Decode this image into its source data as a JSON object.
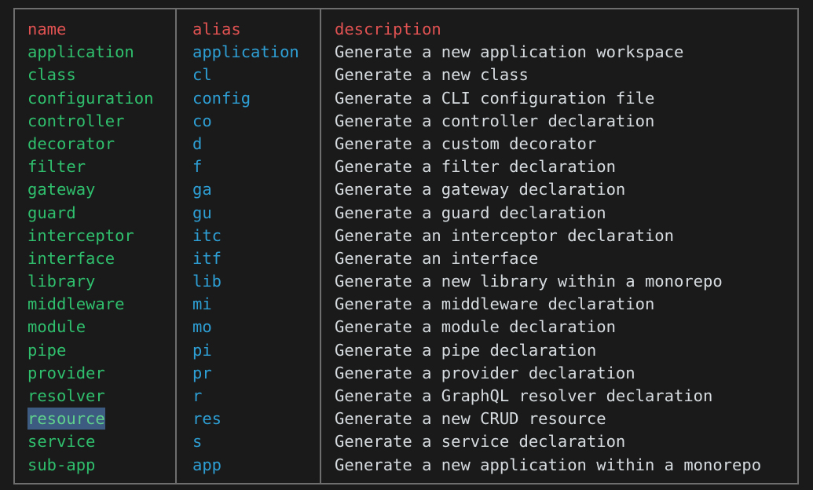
{
  "terminal": {
    "background_color": "#1a1a1a",
    "border_color": "#6e6e6e",
    "header_color": "#e05252",
    "name_color": "#2fbf6d",
    "alias_color": "#2e9fd4",
    "description_color": "#d7dce0",
    "selection_background": "#3d5a80"
  },
  "table": {
    "headers": {
      "name": "name",
      "alias": "alias",
      "description": "description"
    },
    "selected_row": "resource",
    "rows": [
      {
        "name": "application",
        "alias": "application",
        "description": "Generate a new application workspace"
      },
      {
        "name": "class",
        "alias": "cl",
        "description": "Generate a new class"
      },
      {
        "name": "configuration",
        "alias": "config",
        "description": "Generate a CLI configuration file"
      },
      {
        "name": "controller",
        "alias": "co",
        "description": "Generate a controller declaration"
      },
      {
        "name": "decorator",
        "alias": "d",
        "description": "Generate a custom decorator"
      },
      {
        "name": "filter",
        "alias": "f",
        "description": "Generate a filter declaration"
      },
      {
        "name": "gateway",
        "alias": "ga",
        "description": "Generate a gateway declaration"
      },
      {
        "name": "guard",
        "alias": "gu",
        "description": "Generate a guard declaration"
      },
      {
        "name": "interceptor",
        "alias": "itc",
        "description": "Generate an interceptor declaration"
      },
      {
        "name": "interface",
        "alias": "itf",
        "description": "Generate an interface"
      },
      {
        "name": "library",
        "alias": "lib",
        "description": "Generate a new library within a monorepo"
      },
      {
        "name": "middleware",
        "alias": "mi",
        "description": "Generate a middleware declaration"
      },
      {
        "name": "module",
        "alias": "mo",
        "description": "Generate a module declaration"
      },
      {
        "name": "pipe",
        "alias": "pi",
        "description": "Generate a pipe declaration"
      },
      {
        "name": "provider",
        "alias": "pr",
        "description": "Generate a provider declaration"
      },
      {
        "name": "resolver",
        "alias": "r",
        "description": "Generate a GraphQL resolver declaration"
      },
      {
        "name": "resource",
        "alias": "res",
        "description": "Generate a new CRUD resource"
      },
      {
        "name": "service",
        "alias": "s",
        "description": "Generate a service declaration"
      },
      {
        "name": "sub-app",
        "alias": "app",
        "description": "Generate a new application within a monorepo"
      }
    ]
  }
}
